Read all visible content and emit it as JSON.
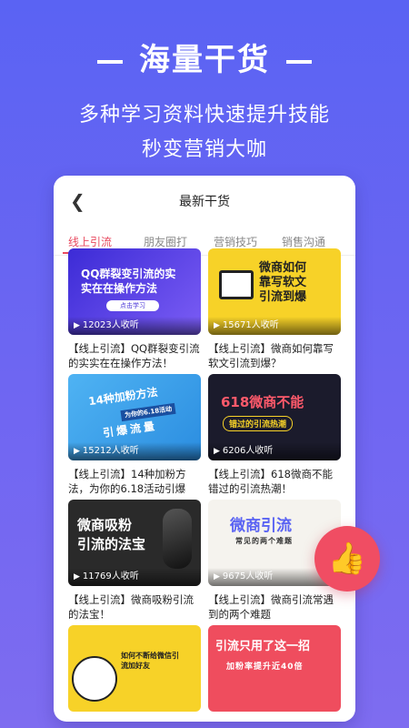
{
  "hero": {
    "title": "海量干货",
    "subtitle_line1": "多种学习资料快速提升技能",
    "subtitle_line2": "秒变营销大咖"
  },
  "screen": {
    "title": "最新干货",
    "tabs": [
      "线上引流",
      "朋友圈打",
      "营销技巧",
      "销售沟通"
    ]
  },
  "cards": [
    {
      "thumb_text": "QQ群裂变引流的实\n实在在操作方法",
      "thumb_badge": "点击学习",
      "listeners": "12023人收听",
      "title": "【线上引流】QQ群裂变引流的实实在在操作方法！"
    },
    {
      "thumb_text": "微商如何\n靠写软文\n引流到爆",
      "listeners": "15671人收听",
      "title": "【线上引流】微商如何靠写软文引流到爆？"
    },
    {
      "thumb_text": "14种加粉方法",
      "thumb_sub": "为你的6.18活动",
      "thumb_badge": "引爆流量",
      "listeners": "15212人收听",
      "title": "【线上引流】14种加粉方法，为你的6.18活动引爆"
    },
    {
      "thumb_text": "618微商不能",
      "thumb_sub": "错过的引流热潮",
      "listeners": "6206人收听",
      "title": "【线上引流】618微商不能错过的引流热潮！"
    },
    {
      "thumb_text": "微商吸粉\n引流的法宝",
      "listeners": "11769人收听",
      "title": "【线上引流】微商吸粉引流的法宝！"
    },
    {
      "thumb_text": "微商引流",
      "thumb_sub": "常见的两个难题",
      "listeners": "9675人收听",
      "title": "【线上引流】微商引流常遇到的两个难题"
    },
    {
      "thumb_text": "如何不断给微信引流加好友"
    },
    {
      "thumb_text": "引流只用了这一招",
      "thumb_sub": "加粉率提升近40倍"
    }
  ],
  "icons": {
    "back": "chevron-left-icon",
    "play": "play-icon",
    "like": "thumbs-up-icon"
  },
  "colors": {
    "accent": "#e84a5f",
    "background": "#5a63f3"
  }
}
